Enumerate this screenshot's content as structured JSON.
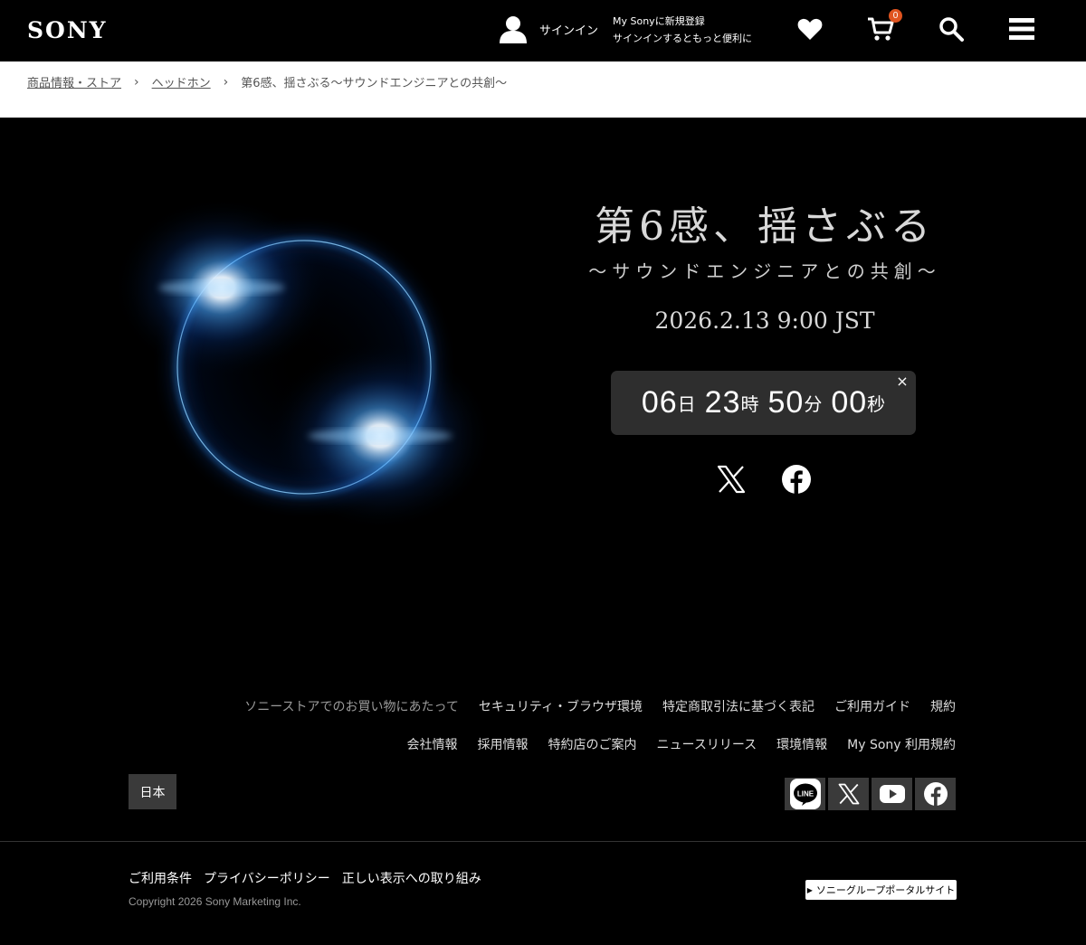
{
  "header": {
    "logo": "SONY",
    "signin_label": "サインイン",
    "mysony_line1": "My Sonyに新規登録",
    "mysony_line2": "サインインするともっと便利に",
    "cart_count": "0",
    "icons": [
      "user-icon",
      "heart-icon",
      "cart-icon",
      "search-icon",
      "menu-icon"
    ]
  },
  "breadcrumb": {
    "items": [
      "商品情報・ストア",
      "ヘッドホン"
    ],
    "current": "第6感、揺さぶる〜サウンドエンジニアとの共創〜"
  },
  "hero": {
    "title": "第6感、揺さぶる",
    "subtitle": "〜サウンドエンジニアとの共創〜",
    "date": "2026.2.13 9:00 JST",
    "countdown": {
      "days": "06",
      "days_unit": "日",
      "hours": "23",
      "hours_unit": "時",
      "minutes": "50",
      "minutes_unit": "分",
      "seconds": "00",
      "seconds_unit": "秒"
    },
    "close_glyph": "×"
  },
  "footer": {
    "links_row1": [
      "ソニーストアでのお買い物にあたって",
      "セキュリティ・ブラウザ環境",
      "特定商取引法に基づく表記",
      "ご利用ガイド",
      "規約"
    ],
    "links_row2": [
      "会社情報",
      "採用情報",
      "特約店のご案内",
      "ニュースリリース",
      "環境情報",
      "My Sony 利用規約"
    ],
    "region": "日本",
    "social_icons": [
      "line-icon",
      "x-icon",
      "youtube-icon",
      "facebook-icon"
    ],
    "line_label": "LINE",
    "legal_links": [
      "ご利用条件",
      "プライバシーポリシー",
      "正しい表示への取り組み"
    ],
    "copyright": "Copyright 2026 Sony Marketing Inc.",
    "group_portal": "ソニーグループポータルサイト"
  },
  "colors": {
    "background": "#000000",
    "cart_badge": "#e0541f",
    "countdown_bg": "#2e2e2e",
    "ring_blue": "#1e8cff"
  }
}
